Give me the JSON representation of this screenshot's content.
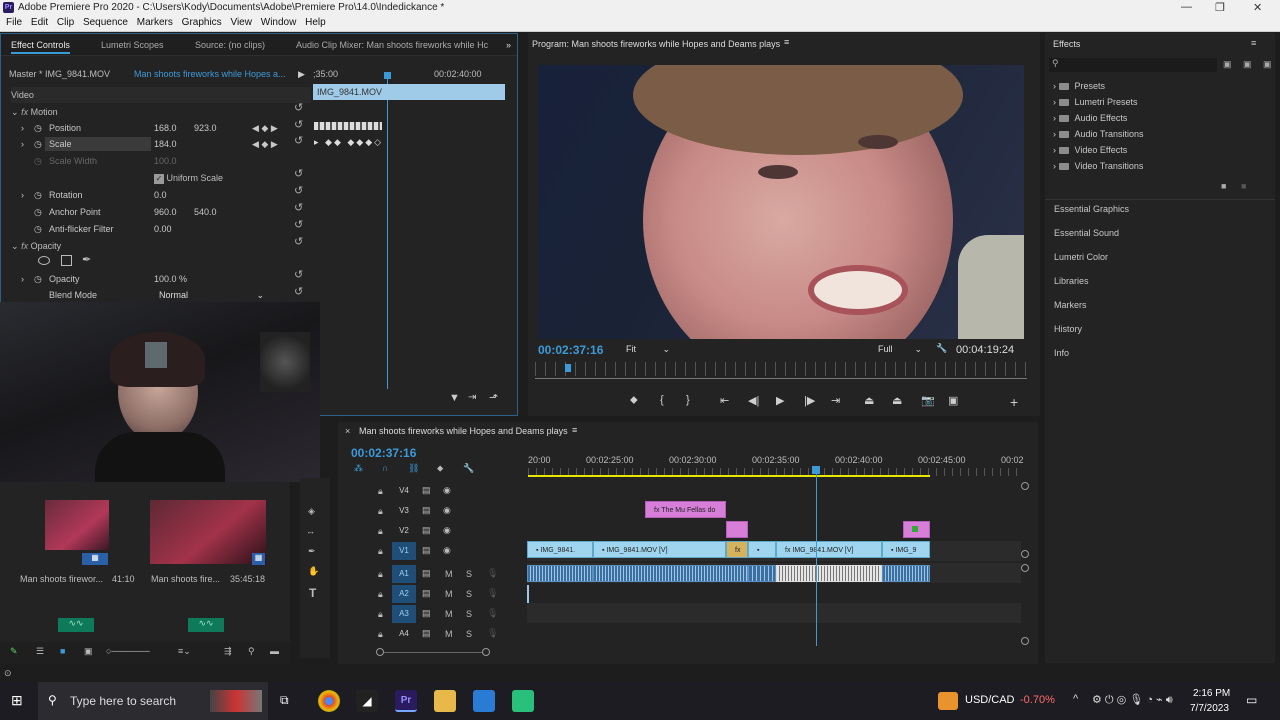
{
  "window": {
    "title": "Adobe Premiere Pro 2020 - C:\\Users\\Kody\\Documents\\Adobe\\Premiere Pro\\14.0\\Indedickance *"
  },
  "menu": [
    "File",
    "Edit",
    "Clip",
    "Sequence",
    "Markers",
    "Graphics",
    "View",
    "Window",
    "Help"
  ],
  "effect_controls": {
    "tabs": [
      "Effect Controls",
      "Lumetri Scopes",
      "Source: (no clips)",
      "Audio Clip Mixer: Man shoots fireworks while Hc"
    ],
    "master": "Master * IMG_9841.MOV",
    "sequence": "Man shoots fireworks while Hopes a...",
    "time_start": ";35:00",
    "time_end": "00:02:40:00",
    "clip_name": "IMG_9841.MOV",
    "video_label": "Video",
    "motion": "Motion",
    "position_label": "Position",
    "position_x": "168.0",
    "position_y": "923.0",
    "scale_label": "Scale",
    "scale_value": "184.0",
    "scale_width_label": "Scale Width",
    "scale_width_value": "100.0",
    "uniform_scale": "Uniform Scale",
    "rotation_label": "Rotation",
    "rotation_value": "0.0",
    "anchor_label": "Anchor Point",
    "anchor_x": "960.0",
    "anchor_y": "540.0",
    "antiflicker_label": "Anti-flicker Filter",
    "antiflicker_value": "0.00",
    "opacity_section": "Opacity",
    "opacity_label": "Opacity",
    "opacity_value": "100.0 %",
    "blend_label": "Blend Mode",
    "blend_value": "Normal"
  },
  "program": {
    "title": "Program: Man shoots fireworks while Hopes and Deams plays",
    "timecode": "00:02:37:16",
    "fit": "Fit",
    "resolution": "Full",
    "duration": "00:04:19:24"
  },
  "effects_panel": {
    "title": "Effects",
    "tree": [
      "Presets",
      "Lumetri Presets",
      "Audio Effects",
      "Audio Transitions",
      "Video Effects",
      "Video Transitions"
    ],
    "panels": [
      "Essential Graphics",
      "Essential Sound",
      "Lumetri Color",
      "Libraries",
      "Markers",
      "History",
      "Info"
    ]
  },
  "project": {
    "items": [
      {
        "name": "Man shoots firewor...",
        "duration": "41:10"
      },
      {
        "name": "Man shoots fire...",
        "duration": "35:45:18"
      }
    ]
  },
  "timeline": {
    "title": "Man shoots fireworks while Hopes and Deams plays",
    "timecode": "00:02:37:16",
    "ruler": [
      "20:00",
      "00:02:25:00",
      "00:02:30:00",
      "00:02:35:00",
      "00:02:40:00",
      "00:02:45:00",
      "00:02"
    ],
    "tracks_video": [
      "V4",
      "V3",
      "V2",
      "V1"
    ],
    "tracks_audio": [
      "A1",
      "A2",
      "A3",
      "A4"
    ],
    "m_label": "M",
    "s_label": "S",
    "title_clip": "The Mu Fellas do",
    "v1_clips": [
      "IMG_9841.",
      "IMG_9841.MOV [V]",
      "IMG_9841.MOV [V]",
      "IMG_9"
    ],
    "fx": "fx"
  },
  "taskbar": {
    "search": "Type here to search",
    "ticker": "USD/CAD",
    "change": "-0.70%",
    "time": "2:16 PM",
    "date": "7/7/2023"
  }
}
